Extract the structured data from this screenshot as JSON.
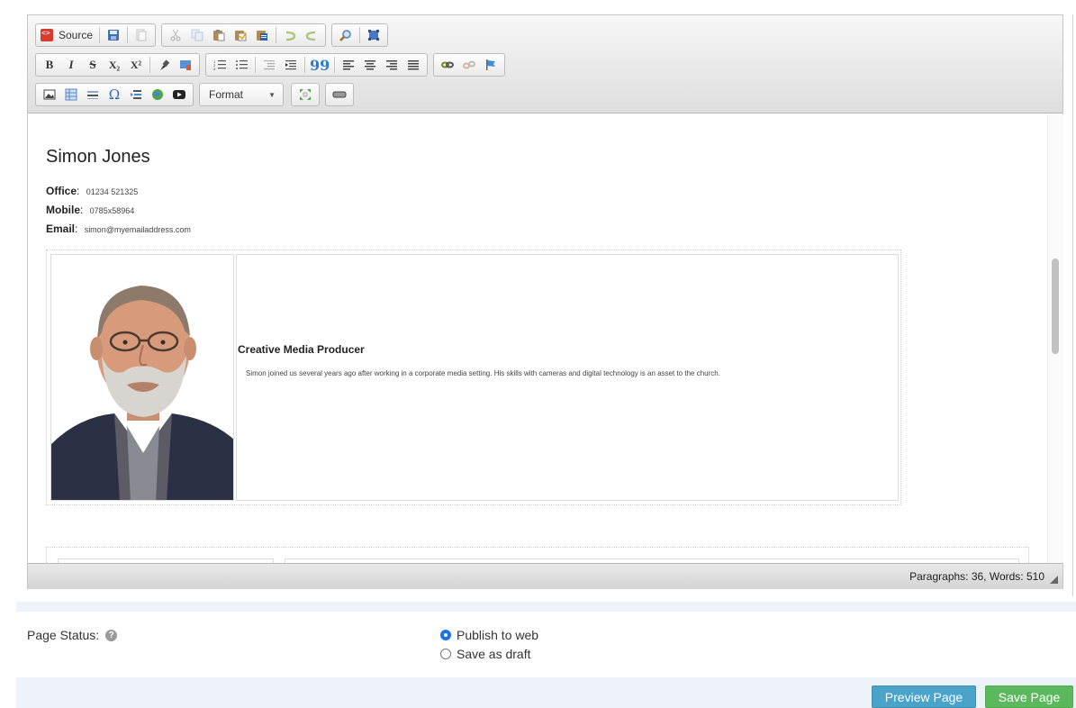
{
  "toolbar": {
    "source_label": "Source",
    "format_label": "Format",
    "icons": [
      "source-icon",
      "save-icon",
      "new-page-icon",
      "cut-icon",
      "copy-icon",
      "paste-icon",
      "paste-text-icon",
      "paste-word-icon",
      "undo-icon",
      "redo-icon",
      "find-icon",
      "select-all-icon",
      "bold-icon",
      "italic-icon",
      "strikethrough-icon",
      "subscript-icon",
      "superscript-icon",
      "remove-format-icon",
      "copy-format-icon",
      "numbered-list-icon",
      "bulleted-list-icon",
      "outdent-icon",
      "indent-icon",
      "blockquote-icon",
      "align-left-icon",
      "align-center-icon",
      "align-right-icon",
      "justify-icon",
      "link-icon",
      "unlink-icon",
      "anchor-icon",
      "image-icon",
      "table-icon",
      "horizontal-rule-icon",
      "special-char-icon",
      "page-break-icon",
      "iframe-icon",
      "youtube-icon",
      "maximize-icon",
      "show-blocks-icon"
    ],
    "bold_glyph": "B",
    "italic_glyph": "I",
    "strike_glyph": "S",
    "sub_glyph": "X₂",
    "sup_glyph": "X²",
    "quote_glyph": "99",
    "omega_glyph": "Ω"
  },
  "document": {
    "name": "Simon Jones",
    "office_label": "Office",
    "office_value": "01234 521325",
    "mobile_label": "Mobile",
    "mobile_value": "0785x58964",
    "email_label": "Email",
    "email_value": "simon@myemailaddress.com",
    "role_title": "Creative Media Producer",
    "role_desc": "Simon joined us several years ago after working in a corporate media setting. His skills with cameras and digital technology is an asset to the church."
  },
  "statusbar": {
    "word_count": "Paragraphs: 36, Words: 510"
  },
  "page_status": {
    "label": "Page Status:",
    "help_glyph": "?",
    "options": [
      "Publish to web",
      "Save as draft"
    ],
    "selected": "Publish to web"
  },
  "footer": {
    "preview_label": "Preview Page",
    "save_label": "Save Page"
  },
  "colors": {
    "preview_button": "#4aa3c8",
    "save_button": "#5cb85c",
    "radio_selected": "#1a73e8"
  }
}
